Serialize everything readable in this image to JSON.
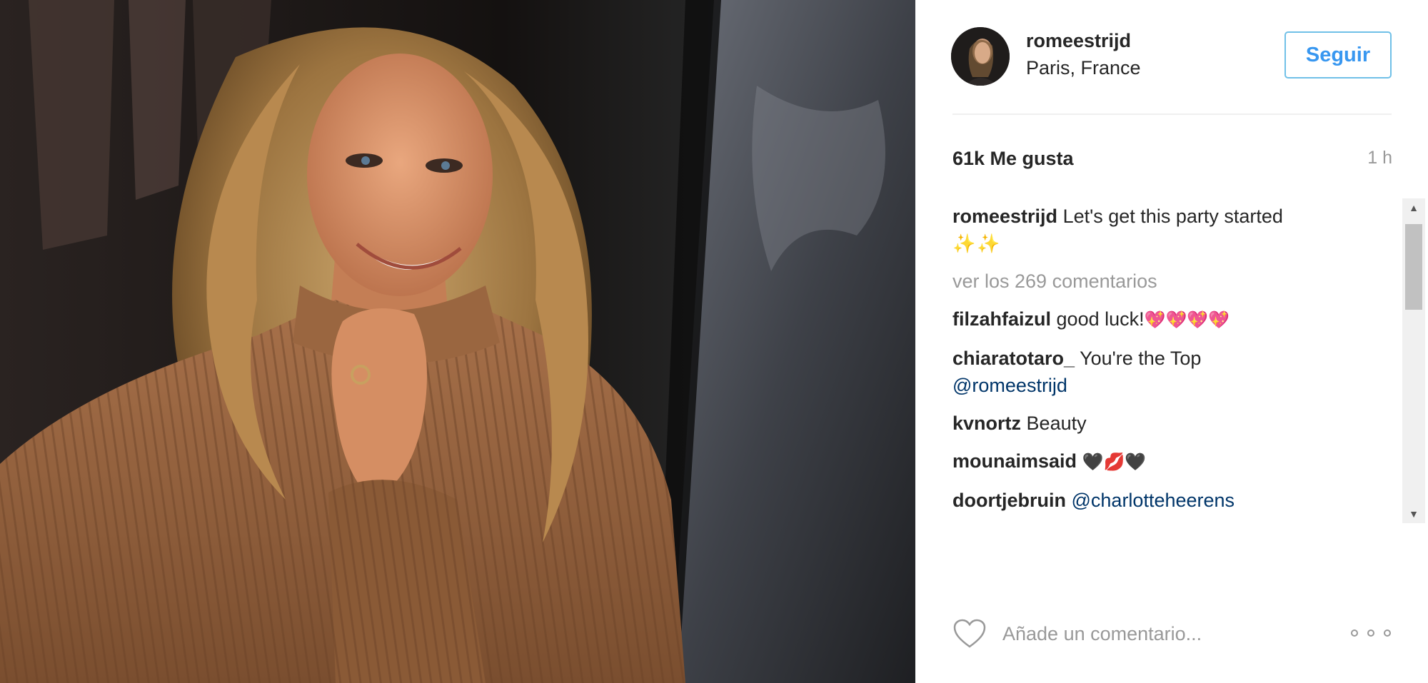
{
  "post": {
    "username": "romeestrijd",
    "location": "Paris, France",
    "follow_label": "Seguir",
    "likes": "61k Me gusta",
    "time_ago": "1 h"
  },
  "caption": {
    "user": "romeestrijd",
    "text": "Let's get this party started",
    "emoji": "✨✨"
  },
  "view_all_comments": "ver los 269 comentarios",
  "comments": [
    {
      "user": "filzahfaizul",
      "text": "good luck!",
      "emoji": "💖💖💖💖"
    },
    {
      "user": "chiaratotaro_",
      "text": "You're the Top",
      "mention": "@romeestrijd"
    },
    {
      "user": "kvnortz",
      "text": "Beauty"
    },
    {
      "user": "mounaimsaid",
      "text": "",
      "emoji": "🖤💋🖤"
    },
    {
      "user": "doortjebruin",
      "text": "",
      "mention": "@charlotteheerens"
    }
  ],
  "add_comment": {
    "placeholder": "Añade un comentario..."
  },
  "icons": {
    "like": "heart-outline-icon",
    "more": "more-options-icon",
    "scroll_up": "▲",
    "scroll_down": "▼"
  },
  "colors": {
    "accent": "#3897f0",
    "follow_border": "#70c0e7",
    "text": "#262626",
    "muted": "#999999",
    "mention": "#003569"
  }
}
